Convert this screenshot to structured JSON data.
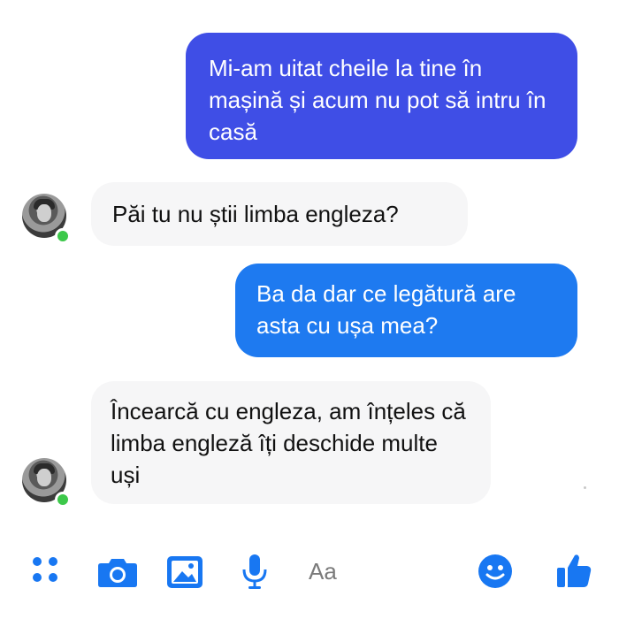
{
  "messages": [
    {
      "side": "outgoing",
      "text": "Mi-am uitat cheile la tine în mașină și acum nu pot să intru în casă"
    },
    {
      "side": "incoming",
      "text": "Păi tu nu știi limba engleza?"
    },
    {
      "side": "outgoing",
      "text": "Ba da dar ce legătură are asta cu ușa mea?"
    },
    {
      "side": "incoming",
      "text": "Încearcă cu engleza, am înțeles că limba engleză îți deschide multe uși"
    }
  ],
  "composer": {
    "placeholder": "Aa"
  },
  "colors": {
    "outgoing_first": "#3f4ee6",
    "outgoing_second": "#1e7af0",
    "incoming": "#f6f6f7",
    "accent": "#1877f2",
    "online": "#3cc84a"
  },
  "icons": [
    "more-icon",
    "camera-icon",
    "gallery-icon",
    "microphone-icon",
    "emoji-icon",
    "like-icon"
  ]
}
